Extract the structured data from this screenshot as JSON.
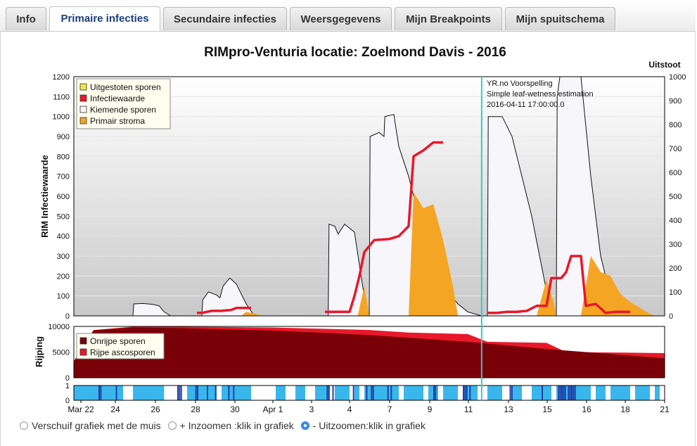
{
  "tabs": [
    {
      "label": "Info",
      "active": false
    },
    {
      "label": "Primaire infecties",
      "active": true
    },
    {
      "label": "Secundaire infecties",
      "active": false
    },
    {
      "label": "Weersgegevens",
      "active": false
    },
    {
      "label": "Mijn Breakpoints",
      "active": false
    },
    {
      "label": "Mijn spuitschema",
      "active": false
    }
  ],
  "chart_data": [
    {
      "type": "area",
      "title": "RIMpro-Venturia locatie:  Zoelmond Davis - 2016",
      "ylabel": "RIM Infectiewaarde",
      "ylabel_right": "Uitstoot",
      "ylim": [
        0,
        1200
      ],
      "ylim_right": [
        0,
        1000
      ],
      "yticks": [
        0,
        100,
        200,
        300,
        400,
        500,
        600,
        700,
        800,
        900,
        1000,
        1100,
        1200
      ],
      "yticks_right": [
        0,
        100,
        200,
        300,
        400,
        500,
        600,
        700,
        800,
        900,
        1000
      ],
      "xlim": [
        "2016-03-22",
        "2016-04-21"
      ],
      "legend": {
        "placement": "top-left",
        "items": [
          {
            "label": "Uitgestoten sporen",
            "color": "#f5e642"
          },
          {
            "label": "Infectiewaarde",
            "color": "#e8182a"
          },
          {
            "label": "Kiemende sporen",
            "color": "#f7f6fb"
          },
          {
            "label": "Primair stroma",
            "color": "#f5a524"
          }
        ]
      },
      "annotation": [
        "YR.no Voorspelling",
        "Simple leaf-wetness estimation",
        "2016-04-11 17:00:00.0"
      ],
      "forecast_marker": "2016-04-11 17:00",
      "marker_color": "#3cc4cc",
      "series": [
        {
          "name": "Kiemende sporen",
          "color": "#f7f6fb",
          "points": [
            [
              "03-25 00:00",
              0
            ],
            [
              "03-25 01:00",
              60
            ],
            [
              "03-25 12:00",
              62
            ],
            [
              "03-26 00:00",
              58
            ],
            [
              "03-26 08:00",
              50
            ],
            [
              "03-26 14:00",
              20
            ],
            [
              "03-26 22:00",
              0
            ],
            [
              "03-28 12:00",
              0
            ],
            [
              "03-28 13:00",
              80
            ],
            [
              "03-28 20:00",
              120
            ],
            [
              "03-29 06:00",
              105
            ],
            [
              "03-29 10:00",
              90
            ],
            [
              "03-29 14:00",
              150
            ],
            [
              "03-29 22:00",
              190
            ],
            [
              "03-30 06:00",
              160
            ],
            [
              "03-30 18:00",
              60
            ],
            [
              "03-31 04:00",
              0
            ],
            [
              "04-03 22:00",
              0
            ],
            [
              "04-03 23:00",
              460
            ],
            [
              "04-04 06:00",
              450
            ],
            [
              "04-04 10:00",
              410
            ],
            [
              "04-04 18:00",
              460
            ],
            [
              "04-05 06:00",
              420
            ],
            [
              "04-05 14:00",
              200
            ],
            [
              "04-05 22:00",
              0
            ],
            [
              "04-06 00:00",
              0
            ],
            [
              "04-06 01:00",
              900
            ],
            [
              "04-06 12:00",
              920
            ],
            [
              "04-06 18:00",
              900
            ],
            [
              "04-06 19:00",
              1000
            ],
            [
              "04-07 06:00",
              1010
            ],
            [
              "04-07 12:00",
              850
            ],
            [
              "04-08 00:00",
              700
            ],
            [
              "04-08 12:00",
              500
            ],
            [
              "04-09 00:00",
              300
            ],
            [
              "04-09 12:00",
              180
            ],
            [
              "04-10 00:00",
              120
            ],
            [
              "04-10 12:00",
              60
            ],
            [
              "04-11 00:00",
              20
            ],
            [
              "04-11 17:00",
              0
            ],
            [
              "04-12 00:00",
              0
            ],
            [
              "04-12 01:00",
              1000
            ],
            [
              "04-12 18:00",
              1000
            ],
            [
              "04-13 06:00",
              900
            ],
            [
              "04-13 18:00",
              700
            ],
            [
              "04-14 06:00",
              500
            ],
            [
              "04-14 18:00",
              250
            ],
            [
              "04-15 06:00",
              0
            ],
            [
              "04-15 12:00",
              0
            ],
            [
              "04-15 13:00",
              1100
            ],
            [
              "04-15 18:00",
              1250
            ],
            [
              "04-16 06:00",
              1300
            ],
            [
              "04-16 18:00",
              1200
            ],
            [
              "04-17 06:00",
              700
            ],
            [
              "04-17 18:00",
              300
            ],
            [
              "04-18 06:00",
              100
            ],
            [
              "04-18 18:00",
              0
            ]
          ]
        },
        {
          "name": "Primair stroma",
          "color": "#f5a524",
          "points": [
            [
              "03-30 12:00",
              0
            ],
            [
              "03-30 18:00",
              20
            ],
            [
              "03-31 06:00",
              10
            ],
            [
              "03-31 12:00",
              0
            ],
            [
              "04-05 10:00",
              0
            ],
            [
              "04-05 18:00",
              150
            ],
            [
              "04-06 00:00",
              0
            ],
            [
              "04-08 00:00",
              0
            ],
            [
              "04-08 06:00",
              620
            ],
            [
              "04-08 18:00",
              540
            ],
            [
              "04-09 06:00",
              560
            ],
            [
              "04-09 18:00",
              380
            ],
            [
              "04-10 06:00",
              150
            ],
            [
              "04-10 12:00",
              0
            ],
            [
              "04-14 12:00",
              0
            ],
            [
              "04-15 00:00",
              180
            ],
            [
              "04-15 08:00",
              80
            ],
            [
              "04-15 12:00",
              0
            ],
            [
              "04-16 18:00",
              0
            ],
            [
              "04-17 06:00",
              300
            ],
            [
              "04-17 18:00",
              220
            ],
            [
              "04-18 06:00",
              200
            ],
            [
              "04-18 18:00",
              110
            ],
            [
              "04-19 06:00",
              70
            ],
            [
              "04-19 18:00",
              40
            ],
            [
              "04-20 06:00",
              10
            ],
            [
              "04-20 12:00",
              0
            ]
          ]
        },
        {
          "name": "Infectiewaarde",
          "color": "#e8182a",
          "points": [
            [
              "03-28 06:00",
              15
            ],
            [
              "03-28 12:00",
              15
            ],
            [
              "03-29 00:00",
              25
            ],
            [
              "03-29 12:00",
              25
            ],
            [
              "03-30 00:00",
              30
            ],
            [
              "03-30 06:00",
              40
            ],
            [
              "03-30 12:00",
              40
            ],
            [
              "03-31 00:00",
              40
            ],
            [
              "04-03 18:00",
              20
            ],
            [
              "04-04 12:00",
              20
            ],
            [
              "04-05 00:00",
              20
            ],
            [
              "04-05 06:00",
              100
            ],
            [
              "04-05 12:00",
              200
            ],
            [
              "04-05 18:00",
              320
            ],
            [
              "04-06 06:00",
              380
            ],
            [
              "04-07 00:00",
              385
            ],
            [
              "04-07 12:00",
              400
            ],
            [
              "04-08 00:00",
              450
            ],
            [
              "04-08 06:00",
              800
            ],
            [
              "04-08 18:00",
              830
            ],
            [
              "04-09 06:00",
              870
            ],
            [
              "04-09 18:00",
              870
            ],
            [
              "04-12 00:00",
              15
            ],
            [
              "04-12 12:00",
              15
            ],
            [
              "04-13 00:00",
              20
            ],
            [
              "04-13 12:00",
              20
            ],
            [
              "04-14 00:00",
              25
            ],
            [
              "04-14 12:00",
              50
            ],
            [
              "04-15 00:00",
              50
            ],
            [
              "04-15 06:00",
              190
            ],
            [
              "04-15 18:00",
              190
            ],
            [
              "04-16 00:00",
              220
            ],
            [
              "04-16 06:00",
              300
            ],
            [
              "04-16 12:00",
              300
            ],
            [
              "04-16 18:00",
              300
            ],
            [
              "04-17 00:00",
              50
            ],
            [
              "04-17 12:00",
              60
            ],
            [
              "04-18 00:00",
              15
            ],
            [
              "04-18 12:00",
              20
            ],
            [
              "04-19 00:00",
              20
            ],
            [
              "04-19 06:00",
              20
            ]
          ]
        }
      ]
    },
    {
      "type": "area",
      "ylabel": "Rijping",
      "ylim": [
        0,
        10000
      ],
      "yticks": [
        0,
        5000,
        10000
      ],
      "legend": {
        "placement": "top-left",
        "items": [
          {
            "label": "Onrijpe sporen",
            "color": "#7a0008"
          },
          {
            "label": "Rijpe ascosporen",
            "color": "#e8182a"
          }
        ]
      },
      "series": [
        {
          "name": "Onrijpe sporen",
          "color": "#7a0008",
          "points": [
            [
              "03-22 00:00",
              3200
            ],
            [
              "03-23 00:00",
              9200
            ],
            [
              "03-25 00:00",
              9800
            ],
            [
              "03-27 00:00",
              9700
            ],
            [
              "03-29 00:00",
              9500
            ],
            [
              "04-01 00:00",
              9200
            ],
            [
              "04-04 00:00",
              8700
            ],
            [
              "04-06 00:00",
              8300
            ],
            [
              "04-08 00:00",
              7800
            ],
            [
              "04-11 00:00",
              7000
            ],
            [
              "04-13 00:00",
              6300
            ],
            [
              "04-15 00:00",
              5600
            ],
            [
              "04-17 00:00",
              5000
            ],
            [
              "04-19 00:00",
              4400
            ],
            [
              "04-21 00:00",
              3800
            ]
          ]
        },
        {
          "name": "Rijpe ascosporen",
          "color": "#e8182a",
          "points": [
            [
              "03-22 00:00",
              3200
            ],
            [
              "03-23 00:00",
              9300
            ],
            [
              "03-25 00:00",
              9950
            ],
            [
              "03-27 00:00",
              9950
            ],
            [
              "03-29 00:00",
              9900
            ],
            [
              "04-01 00:00",
              9800
            ],
            [
              "04-04 00:00",
              9500
            ],
            [
              "04-06 00:00",
              9300
            ],
            [
              "04-08 00:00",
              8800
            ],
            [
              "04-11 00:00",
              8500
            ],
            [
              "04-12 00:00",
              7000
            ],
            [
              "04-15 00:00",
              6800
            ],
            [
              "04-16 00:00",
              5000
            ],
            [
              "04-19 00:00",
              4900
            ],
            [
              "04-21 00:00",
              4800
            ]
          ]
        }
      ]
    },
    {
      "type": "bar",
      "ylim": [
        0,
        1
      ],
      "yticks": [
        0,
        1
      ],
      "xlabels": [
        "Mar 22",
        "24",
        "26",
        "28",
        "30",
        "Apr 1",
        "3",
        "4",
        "7",
        "9",
        "11",
        "13",
        "15",
        "16",
        "18",
        "21"
      ],
      "colors": {
        "wet": "#39b7ec",
        "rain": "#1f3fa8"
      },
      "wet_periods": [
        [
          "03-22 00:00",
          "03-24 12:00"
        ],
        [
          "03-25 00:00",
          "03-26 14:00"
        ],
        [
          "03-27 18:00",
          "03-29 06:00"
        ],
        [
          "03-29 12:00",
          "03-31 00:00"
        ],
        [
          "04-01 06:00",
          "04-01 18:00"
        ],
        [
          "04-02 06:00",
          "04-02 18:00"
        ],
        [
          "04-03 06:00",
          "04-04 00:00"
        ],
        [
          "04-04 06:00",
          "04-05 00:00"
        ],
        [
          "04-05 06:00",
          "04-05 12:00"
        ],
        [
          "04-05 18:00",
          "04-07 12:00"
        ],
        [
          "04-07 18:00",
          "04-08 18:00"
        ],
        [
          "04-09 00:00",
          "04-09 12:00"
        ],
        [
          "04-09 18:00",
          "04-10 12:00"
        ],
        [
          "04-10 18:00",
          "04-11 12:00"
        ],
        [
          "04-12 00:00",
          "04-12 18:00"
        ],
        [
          "04-13 06:00",
          "04-13 18:00"
        ],
        [
          "04-14 06:00",
          "04-15 06:00"
        ],
        [
          "04-15 12:00",
          "04-17 06:00"
        ],
        [
          "04-17 12:00",
          "04-18 00:00"
        ],
        [
          "04-18 06:00",
          "04-19 06:00"
        ],
        [
          "04-19 12:00",
          "04-20 06:00"
        ],
        [
          "04-20 12:00",
          "04-20 18:00"
        ]
      ],
      "rain_marks": [
        "03-23 06:00",
        "03-23 08:00",
        "03-24 03:00",
        "03-27 06:00",
        "03-27 08:00",
        "03-27 10:00",
        "03-28 04:00",
        "03-28 06:00",
        "03-28 18:00",
        "03-29 04:00",
        "03-29 20:00",
        "03-30 02:00",
        "04-03 20:00",
        "04-03 22:00",
        "04-04 03:00",
        "04-05 04:00",
        "04-05 20:00",
        "04-06 02:00",
        "04-06 04:00",
        "04-06 22:00",
        "04-07 02:00",
        "04-09 06:00",
        "04-09 08:00",
        "04-10 18:00",
        "04-10 20:00",
        "04-10 22:00",
        "04-11 02:00",
        "04-13 03:00",
        "04-13 05:00",
        "04-14 18:00",
        "04-15 14:00",
        "04-15 16:00",
        "04-15 18:00",
        "04-15 20:00",
        "04-15 22:00",
        "04-16 02:00",
        "04-16 04:00",
        "04-16 06:00",
        "04-16 08:00",
        "04-16 10:00"
      ]
    }
  ],
  "controls": {
    "options": [
      {
        "label": "Verschuif grafiek met de muis",
        "selected": false
      },
      {
        "label": "+ Inzoomen :klik in grafiek",
        "selected": false
      },
      {
        "label": "- Uitzoomen:klik in grafiek",
        "selected": true
      }
    ]
  }
}
